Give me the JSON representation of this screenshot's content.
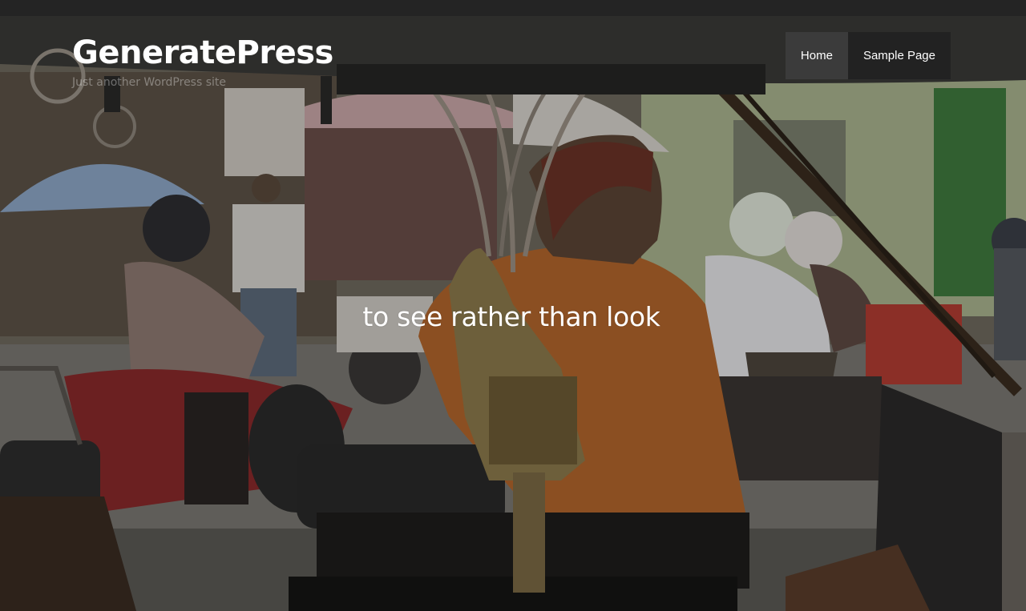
{
  "site": {
    "title": "GeneratePress",
    "tagline": "Just another WordPress site"
  },
  "nav": {
    "items": [
      {
        "label": "Home",
        "current": true
      },
      {
        "label": "Sample Page",
        "current": false
      }
    ]
  },
  "hero": {
    "text": "to see rather than look"
  },
  "colors": {
    "nav_current_bg": "#3b3b3b",
    "nav_item_bg": "#222222",
    "text": "#ffffff"
  }
}
